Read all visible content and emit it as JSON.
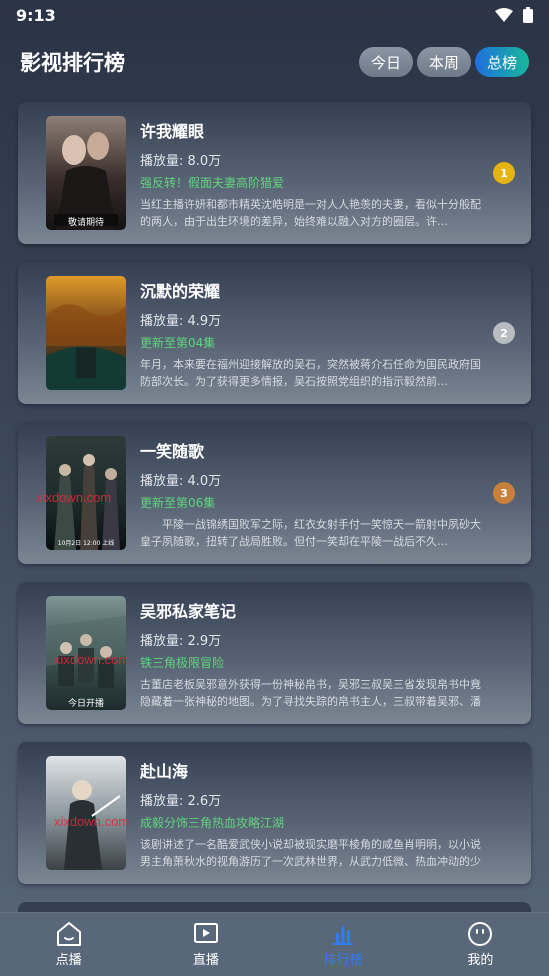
{
  "status_bar": {
    "time": "9:13"
  },
  "header": {
    "title": "影视排行榜",
    "tabs": [
      {
        "label": "今日",
        "active": false
      },
      {
        "label": "本周",
        "active": false
      },
      {
        "label": "总榜",
        "active": true
      }
    ]
  },
  "items": [
    {
      "title": "许我耀眼",
      "plays": "播放量: 8.0万",
      "tag": "强反转！假面夫妻高阶猎爱",
      "desc": "当红主播许妍和都市精英沈皓明是一对人人艳羡的夫妻，看似十分般配的两人，由于出生环境的差异，始终难以融入对方的圈层。许…",
      "rank": "1",
      "rank_color": "#e6b412",
      "poster_text": "敬请期待"
    },
    {
      "title": "沉默的荣耀",
      "plays": "播放量: 4.9万",
      "tag": "更新至第04集",
      "desc": "年月，本来要在福州迎接解放的吴石，突然被蒋介石任命为国民政府国防部次长。为了获得更多情报，吴石按照党组织的指示毅然前…",
      "rank": "2",
      "rank_color": "#b9bdc2"
    },
    {
      "title": "一笑随歌",
      "plays": "播放量: 4.0万",
      "tag": "更新至第06集",
      "desc": "　　平陵一战锦绣国败军之际，红衣女射手付一笑惊天一箭射中夙砂大皇子夙随歌，扭转了战局胜败。但付一笑却在平陵一战后不久…",
      "rank": "3",
      "rank_color": "#c9803a",
      "poster_text": "10月2日 12:00 上线",
      "watermark": "xixdown.com"
    },
    {
      "title": "吴邪私家笔记",
      "plays": "播放量: 2.9万",
      "tag": "铁三角极限冒险",
      "desc": "古董店老板吴邪意外获得一份神秘帛书，吴邪三叔吴三省发现帛书中竟隐藏着一张神秘的地图。为了寻找失踪的帛书主人，三叔带着吴邪、潘子、小…",
      "poster_text": "今日开播",
      "watermark": "xixdown.com"
    },
    {
      "title": "赴山海",
      "plays": "播放量: 2.6万",
      "tag": "成毅分饰三角热血攻略江湖",
      "desc": "该剧讲述了一名酷爱武侠小说却被现实磨平棱角的咸鱼肖明明，以小说男主角萧秋水的视角游历了一次武林世界，从武力低微、热血冲动的少年剑客…",
      "watermark": "xixdown.com"
    }
  ],
  "nav": {
    "items": [
      {
        "label": "点播",
        "icon": "home-icon",
        "active": false
      },
      {
        "label": "直播",
        "icon": "play-icon",
        "active": false
      },
      {
        "label": "排行榜",
        "icon": "chart-icon",
        "active": true
      },
      {
        "label": "我的",
        "icon": "face-icon",
        "active": false
      }
    ]
  },
  "colors": {
    "accent": "#2f7cf6",
    "tag_green": "#5fd47c",
    "tab_active_start": "#1e6fe0",
    "tab_active_end": "#18b89a"
  }
}
